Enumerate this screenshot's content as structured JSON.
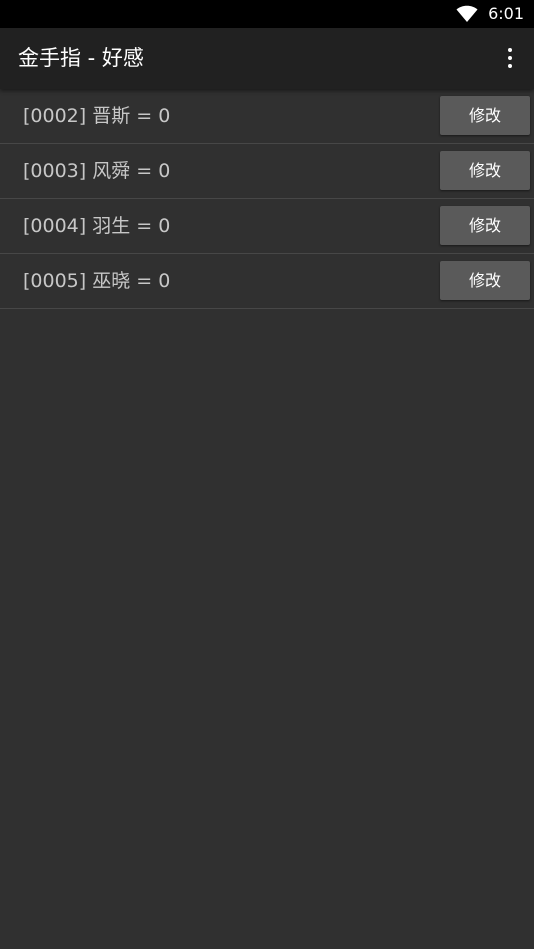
{
  "status_bar": {
    "time": "6:01",
    "icons": [
      "wifi-icon"
    ]
  },
  "app_bar": {
    "title": "金手指 - 好感",
    "menu_icon": "overflow-menu-icon"
  },
  "rows": [
    {
      "label": "[0002] 晋斯 = 0",
      "button": "修改"
    },
    {
      "label": "[0003] 风舜 = 0",
      "button": "修改"
    },
    {
      "label": "[0004] 羽生 = 0",
      "button": "修改"
    },
    {
      "label": "[0005] 巫晓 = 0",
      "button": "修改"
    }
  ],
  "colors": {
    "background": "#303030",
    "app_bar": "#212121",
    "button": "#5a5a5a",
    "text": "#c7c7c7"
  }
}
